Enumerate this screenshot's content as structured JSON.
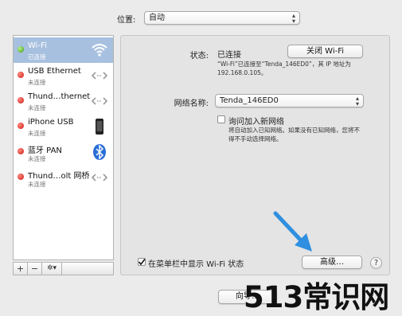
{
  "location": {
    "label": "位置:",
    "value": "自动"
  },
  "services": [
    {
      "name": "Wi-Fi",
      "status": "已连接",
      "status_color": "green",
      "icon": "wifi-icon",
      "selected": true
    },
    {
      "name": "USB Ethernet",
      "status": "未连接",
      "status_color": "red",
      "icon": "ethernet-arrows-icon"
    },
    {
      "name": "Thund…thernet",
      "status": "未连接",
      "status_color": "red",
      "icon": "ethernet-arrows-icon"
    },
    {
      "name": "iPhone USB",
      "status": "未连接",
      "status_color": "red",
      "icon": "iphone-icon"
    },
    {
      "name": "蓝牙 PAN",
      "status": "未连接",
      "status_color": "red",
      "icon": "bluetooth-icon"
    },
    {
      "name": "Thund…olt 网桥",
      "status": "未连接",
      "status_color": "red",
      "icon": "ethernet-arrows-icon"
    }
  ],
  "toolbar": {
    "add": "+",
    "remove": "−",
    "gear": "✲▾"
  },
  "detail": {
    "status_label": "状态:",
    "status_value": "已连接",
    "turn_off_button": "关闭 Wi-Fi",
    "status_desc": "“Wi-Fi”已连接至“Tenda_146ED0”，其 IP 地址为 192.168.0.105。",
    "network_name_label": "网络名称:",
    "network_name_value": "Tenda_146ED0",
    "ask_join_label": "询问加入新网络",
    "ask_join_desc": "将自动加入已知网络。如果没有已知网络，您将不得不手动选择网络。",
    "show_in_menubar_label": "在菜单栏中显示 Wi-Fi 状态",
    "advanced_button": "高级…",
    "help_button": "?",
    "assistant_button": "向导…"
  },
  "watermark": "513常识网",
  "colors": {
    "selection": "#a7c0df",
    "arrow": "#2f8fe0",
    "status_green": "#3d9a16",
    "status_red": "#cc1a12"
  }
}
